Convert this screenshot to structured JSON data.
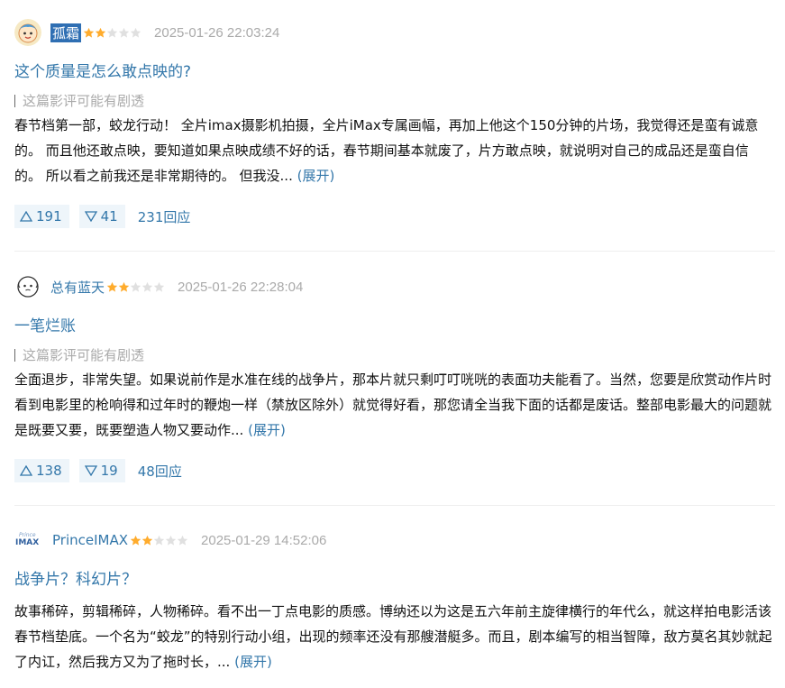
{
  "reviews": [
    {
      "author": "孤霜",
      "rating": 2,
      "time": "2025-01-26 22:03:24",
      "title": "这个质量是怎么敢点映的?",
      "spoiler": "这篇影评可能有剧透",
      "body": "春节档第一部，蛟龙行动！ 全片imax摄影机拍摄，全片iMax专属画幅，再加上他这个150分钟的片场，我觉得还是蛮有诚意的。 而且他还敢点映，要知道如果点映成绩不好的话，春节期间基本就废了，片方敢点映，就说明对自己的成品还是蛮自信的。 所以看之前我还是非常期待的。 但我没...",
      "expand": "(展开)",
      "up": "191",
      "down": "41",
      "replies": "231回应"
    },
    {
      "author": "总有蓝天",
      "rating": 2,
      "time": "2025-01-26 22:28:04",
      "title": "一笔烂账",
      "spoiler": "这篇影评可能有剧透",
      "body": "全面退步，非常失望。如果说前作是水准在线的战争片，那本片就只剩叮叮咣咣的表面功夫能看了。当然，您要是欣赏动作片时看到电影里的枪响得和过年时的鞭炮一样（禁放区除外）就觉得好看，那您请全当我下面的话都是废话。整部电影最大的问题就是既要又要，既要塑造人物又要动作...",
      "expand": "(展开)",
      "up": "138",
      "down": "19",
      "replies": "48回应"
    },
    {
      "author": "PrinceIMAX",
      "avatar_text": "IMAX",
      "rating": 2,
      "time": "2025-01-29 14:52:06",
      "title": "战争片？科幻片？",
      "body": "故事稀碎，剪辑稀碎，人物稀碎。看不出一丁点电影的质感。博纳还以为这是五六年前主旋律横行的年代么，就这样拍电影活该春节档垫底。一个名为“蛟龙”的特别行动小组，出现的频率还没有那艘潜艇多。而且，剧本编写的相当智障，敌方莫名其妙就起了内讧，然后我方又为了拖时长，...",
      "expand": "(展开)"
    }
  ],
  "colors": {
    "link": "#3377aa",
    "muted": "#aaaaaa",
    "star": "#ffac2d",
    "vote_bg": "#eef5fa"
  }
}
